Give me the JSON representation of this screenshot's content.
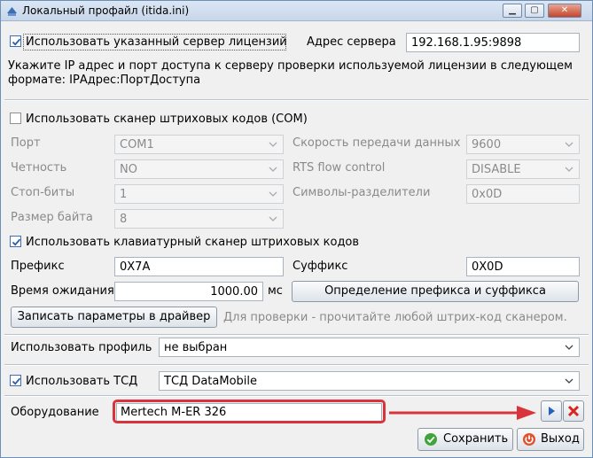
{
  "window": {
    "title": "Локальный профайл (itida.ini)",
    "colors": {
      "highlight": "#d9343b",
      "accent": "#3c6fb5"
    }
  },
  "license": {
    "use_server_label": "Использовать указанный сервер лицензий",
    "use_server_checked": true,
    "address_label": "Адрес сервера",
    "address_value": "192.168.1.95:9898",
    "hint_line1": "Укажите IP адрес и порт доступа к серверу проверки используемой лицензии в следующем",
    "hint_line2": "формате: IPАдрес:ПортДоступа"
  },
  "com_scanner": {
    "use_label": "Использовать сканер штриховых кодов (COM)",
    "checked": false,
    "port_label": "Порт",
    "port_value": "COM1",
    "speed_label": "Скорость передачи данных",
    "speed_value": "9600",
    "parity_label": "Четность",
    "parity_value": "NO",
    "rts_label": "RTS flow control",
    "rts_value": "DISABLE",
    "stop_label": "Стоп-биты",
    "stop_value": "1",
    "delim_label": "Символы-разделители",
    "delim_value": "0x0D",
    "bytesize_label": "Размер байта",
    "bytesize_value": "8"
  },
  "kb_scanner": {
    "use_label": "Использовать клавиатурный сканер штриховых кодов",
    "checked": true,
    "prefix_label": "Префикс",
    "prefix_value": "0X7A",
    "suffix_label": "Суффикс",
    "suffix_value": "0X0D",
    "timeout_label": "Время ожидания",
    "timeout_value": "1000.00",
    "timeout_unit": "мс",
    "detect_button": "Определение префикса и суффикса",
    "write_button": "Записать параметры в драйвер",
    "write_hint": "Для проверки - прочитайте любой штрих-код сканером."
  },
  "profile": {
    "label": "Использовать профиль",
    "value": "не выбран"
  },
  "tsd": {
    "label": "Использовать ТСД",
    "checked": true,
    "value": "ТСД DataMobile"
  },
  "equipment": {
    "label": "Оборудование",
    "value": "Mertech M-ER 326"
  },
  "footer": {
    "save_button": "Сохранить",
    "exit_button": "Выход"
  }
}
